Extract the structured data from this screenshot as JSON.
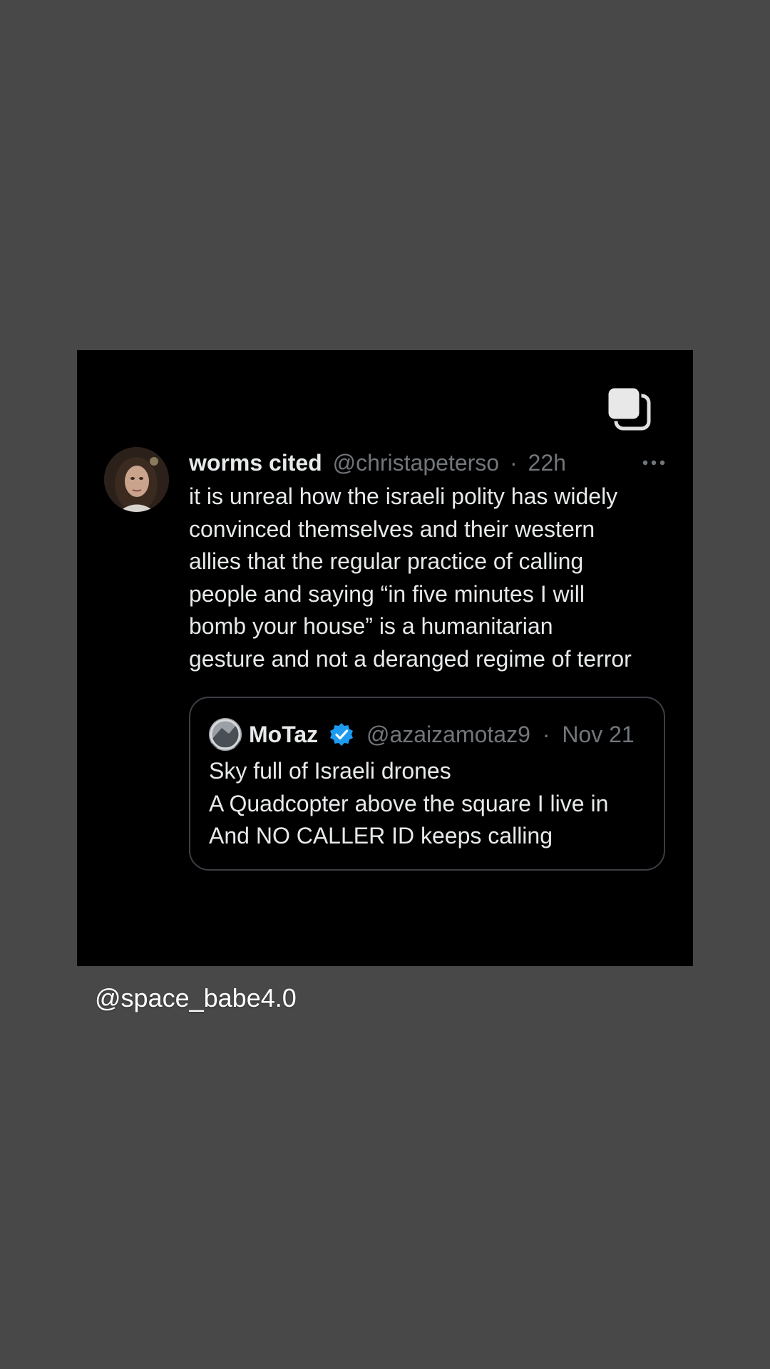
{
  "tweet": {
    "author_name": "worms cited",
    "author_handle": "@christapeterso",
    "separator": "·",
    "time": "22h",
    "text": "it is unreal how the israeli polity has widely\nconvinced themselves and their western\nallies that the regular practice of calling\npeople and saying “in five minutes I will\nbomb your house” is a humanitarian\ngesture and not a deranged regime of terror",
    "more_icon": "ellipsis-icon",
    "multi_image_icon": "multiple-images-icon"
  },
  "quoted_tweet": {
    "author_name": "MoTaz",
    "verified_icon": "verified-badge-icon",
    "author_handle": "@azaizamotaz9",
    "separator": "·",
    "date": "Nov 21",
    "text": "Sky full of Israeli drones\nA Quadcopter above the square I live in\nAnd NO CALLER ID keeps calling"
  },
  "story": {
    "mention": "@space_babe4.0"
  },
  "colors": {
    "background": "#484848",
    "post_background": "#000000",
    "primary_text": "#e7e9ea",
    "secondary_text": "#71767b",
    "verified_blue": "#1d9bf0",
    "quote_border": "#3b3f43"
  }
}
